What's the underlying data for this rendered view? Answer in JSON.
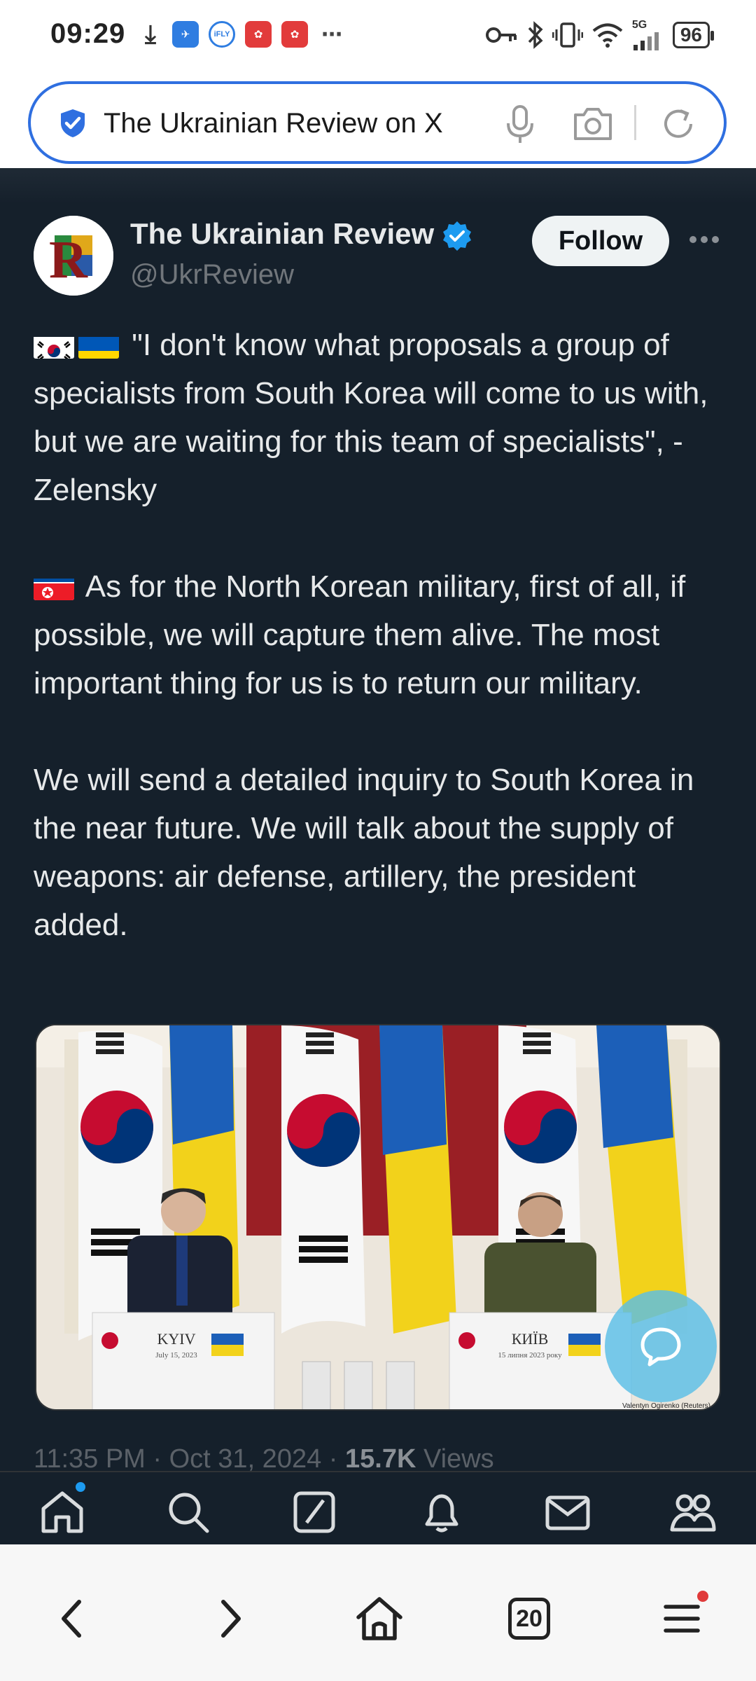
{
  "status_bar": {
    "time": "09:29",
    "left_icons": [
      "download-icon",
      "app-icon",
      "ifly-icon",
      "app-icon",
      "app-icon",
      "more-dots-icon"
    ],
    "ifly_label": "iFLY",
    "signal_label": "5G",
    "battery": "96"
  },
  "address_bar": {
    "text": "The Ukrainian Review on X",
    "accent_color": "#2f6fe0"
  },
  "tweet": {
    "author_name": "The Ukrainian Review",
    "handle": "@UkrReview",
    "avatar_letter": "R",
    "follow_label": "Follow",
    "paragraph1": "\"I don't know what proposals a group of specialists from South Korea will come to us with, but we are waiting for this team of specialists\", - Zelensky",
    "paragraph2": "As for the North Korean military, first of all, if possible, we will capture them alive. The most important thing for us is to return our military.",
    "paragraph3": "We will send a detailed inquiry to South Korea in the near future. We will talk about the supply of weapons: air defense, artillery, the president added.",
    "photo": {
      "left_podium_sign": "KYIV",
      "left_podium_date": "July 15, 2023",
      "right_podium_sign": "КИЇВ",
      "right_podium_date": "15 липня 2023 року",
      "credit": "Valentyn Ogirenko (Reuters)"
    },
    "time": "11:35 PM",
    "date": "Oct 31, 2024",
    "views_count": "15.7K",
    "views_label": "Views",
    "separator": "·"
  },
  "x_tabbar": [
    "home-icon",
    "search-icon",
    "grok-icon",
    "notifications-icon",
    "messages-icon",
    "communities-icon"
  ],
  "browser_nav": {
    "tabs_count": "20"
  },
  "colors": {
    "background": "#15202b",
    "text": "#e7e9ea",
    "muted": "#71767b",
    "verified": "#1d9bf0"
  }
}
